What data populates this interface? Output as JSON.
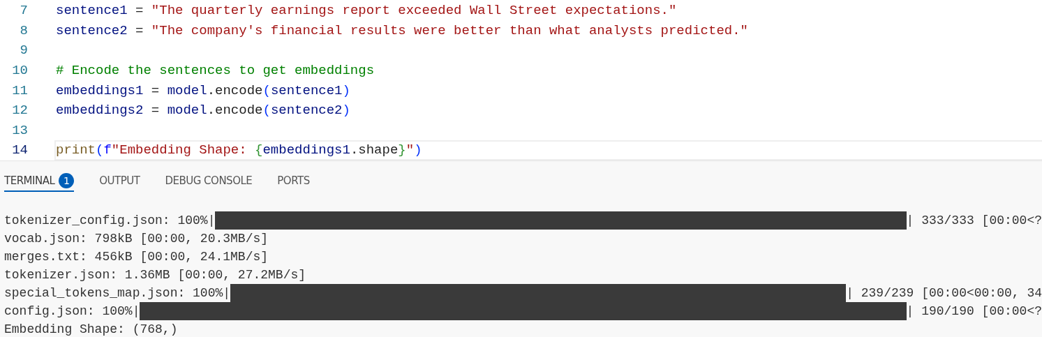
{
  "editor": {
    "lines": [
      {
        "number": "7",
        "current": false,
        "tokens": [
          {
            "kind": "var",
            "text": "sentence1"
          },
          {
            "kind": "op",
            "text": " = "
          },
          {
            "kind": "str",
            "text": "\"The quarterly earnings report exceeded Wall Street expectations.\""
          }
        ]
      },
      {
        "number": "8",
        "current": false,
        "tokens": [
          {
            "kind": "var",
            "text": "sentence2"
          },
          {
            "kind": "op",
            "text": " = "
          },
          {
            "kind": "str",
            "text": "\"The company's financial results were better than what analysts predicted.\""
          }
        ]
      },
      {
        "number": "9",
        "current": false
      },
      {
        "number": "10",
        "current": false,
        "tokens": [
          {
            "kind": "comment",
            "text": "# Encode the sentences to get embeddings"
          }
        ]
      },
      {
        "number": "11",
        "current": false,
        "tokens": [
          {
            "kind": "var",
            "text": "embeddings1"
          },
          {
            "kind": "op",
            "text": " = "
          },
          {
            "kind": "var",
            "text": "model"
          },
          {
            "kind": "op",
            "text": ".encode"
          },
          {
            "kind": "paren",
            "text": "("
          },
          {
            "kind": "var",
            "text": "sentence1"
          },
          {
            "kind": "paren",
            "text": ")"
          }
        ]
      },
      {
        "number": "12",
        "current": false,
        "tokens": [
          {
            "kind": "var",
            "text": "embeddings2"
          },
          {
            "kind": "op",
            "text": " = "
          },
          {
            "kind": "var",
            "text": "model"
          },
          {
            "kind": "op",
            "text": ".encode"
          },
          {
            "kind": "paren",
            "text": "("
          },
          {
            "kind": "var",
            "text": "sentence2"
          },
          {
            "kind": "paren",
            "text": ")"
          }
        ]
      },
      {
        "number": "13",
        "current": false
      },
      {
        "number": "14",
        "current": true,
        "tokens": [
          {
            "kind": "func",
            "text": "print"
          },
          {
            "kind": "paren",
            "text": "("
          },
          {
            "kind": "keyword",
            "text": "f"
          },
          {
            "kind": "str",
            "text": "\"Embedding Shape: "
          },
          {
            "kind": "brace",
            "text": "{"
          },
          {
            "kind": "var",
            "text": "embeddings1"
          },
          {
            "kind": "op",
            "text": ".shape"
          },
          {
            "kind": "brace",
            "text": "}"
          },
          {
            "kind": "str",
            "text": "\""
          },
          {
            "kind": "paren",
            "text": ")"
          }
        ]
      }
    ]
  },
  "panel": {
    "tabs": [
      {
        "label": "TERMINAL",
        "selected": true,
        "badge": "1"
      },
      {
        "label": "OUTPUT",
        "selected": false
      },
      {
        "label": "DEBUG CONSOLE",
        "selected": false
      },
      {
        "label": "PORTS",
        "selected": false
      }
    ],
    "terminal_lines": [
      {
        "kind": "progress",
        "label": "tokenizer_config.json: 100%|",
        "tail": "| 333/333 [00:00<?"
      },
      {
        "kind": "text",
        "text": "vocab.json: 798kB [00:00, 20.3MB/s]"
      },
      {
        "kind": "text",
        "text": "merges.txt: 456kB [00:00, 24.1MB/s]"
      },
      {
        "kind": "text",
        "text": "tokenizer.json: 1.36MB [00:00, 27.2MB/s]"
      },
      {
        "kind": "progress",
        "label": "special_tokens_map.json: 100%|",
        "tail": "| 239/239 [00:00<00:00, 34"
      },
      {
        "kind": "progress",
        "label": "config.json: 100%|",
        "tail": "| 190/190 [00:00<?"
      },
      {
        "kind": "text",
        "text": "Embedding Shape: (768,)"
      }
    ]
  }
}
